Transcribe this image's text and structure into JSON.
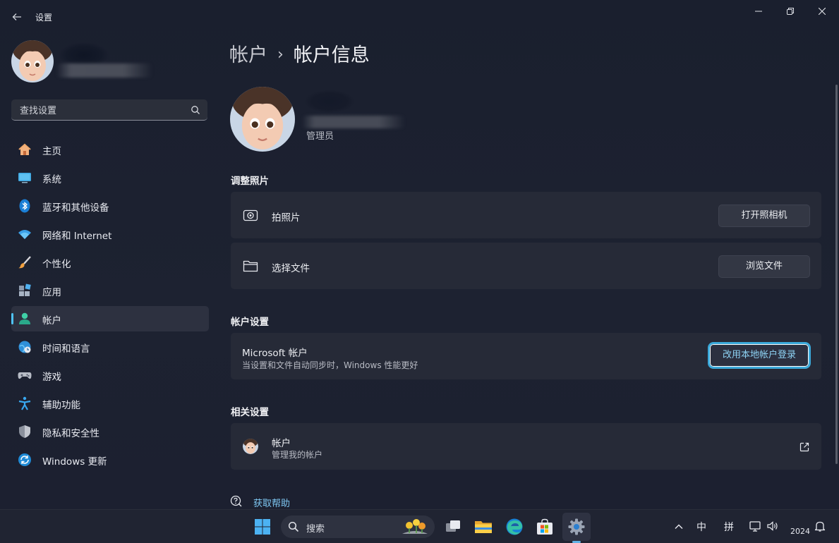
{
  "window": {
    "title": "设置"
  },
  "sidebar": {
    "search_placeholder": "查找设置",
    "items": [
      {
        "label": "主页",
        "icon": "home-icon"
      },
      {
        "label": "系统",
        "icon": "monitor-icon"
      },
      {
        "label": "蓝牙和其他设备",
        "icon": "bluetooth-icon"
      },
      {
        "label": "网络和 Internet",
        "icon": "wifi-icon"
      },
      {
        "label": "个性化",
        "icon": "brush-icon"
      },
      {
        "label": "应用",
        "icon": "apps-icon"
      },
      {
        "label": "帐户",
        "icon": "person-icon",
        "active": true
      },
      {
        "label": "时间和语言",
        "icon": "globe-clock-icon"
      },
      {
        "label": "游戏",
        "icon": "gamepad-icon"
      },
      {
        "label": "辅助功能",
        "icon": "accessibility-icon"
      },
      {
        "label": "隐私和安全性",
        "icon": "shield-icon"
      },
      {
        "label": "Windows 更新",
        "icon": "update-icon"
      }
    ]
  },
  "main": {
    "breadcrumb": {
      "parent": "帐户",
      "separator": "›",
      "current": "帐户信息"
    },
    "user": {
      "role": "管理员"
    },
    "adjust_photo": {
      "title": "调整照片",
      "take_photo": {
        "label": "拍照片",
        "button": "打开照相机"
      },
      "choose_file": {
        "label": "选择文件",
        "button": "浏览文件"
      }
    },
    "account_settings": {
      "title": "帐户设置",
      "microsoft": {
        "label": "Microsoft 帐户",
        "description": "当设置和文件自动同步时，Windows 性能更好",
        "button": "改用本地帐户登录"
      }
    },
    "related": {
      "title": "相关设置",
      "accounts": {
        "label": "帐户",
        "description": "管理我的帐户"
      }
    },
    "help": {
      "label": "获取帮助"
    }
  },
  "taskbar": {
    "search_label": "搜索",
    "ime_mode": "中",
    "ime_name": "拼",
    "year": "2024"
  },
  "colors": {
    "accent": "#4fc3f7",
    "focus_ring": "#3aa8d9",
    "background": "#1c2030",
    "card": "#262a37"
  }
}
